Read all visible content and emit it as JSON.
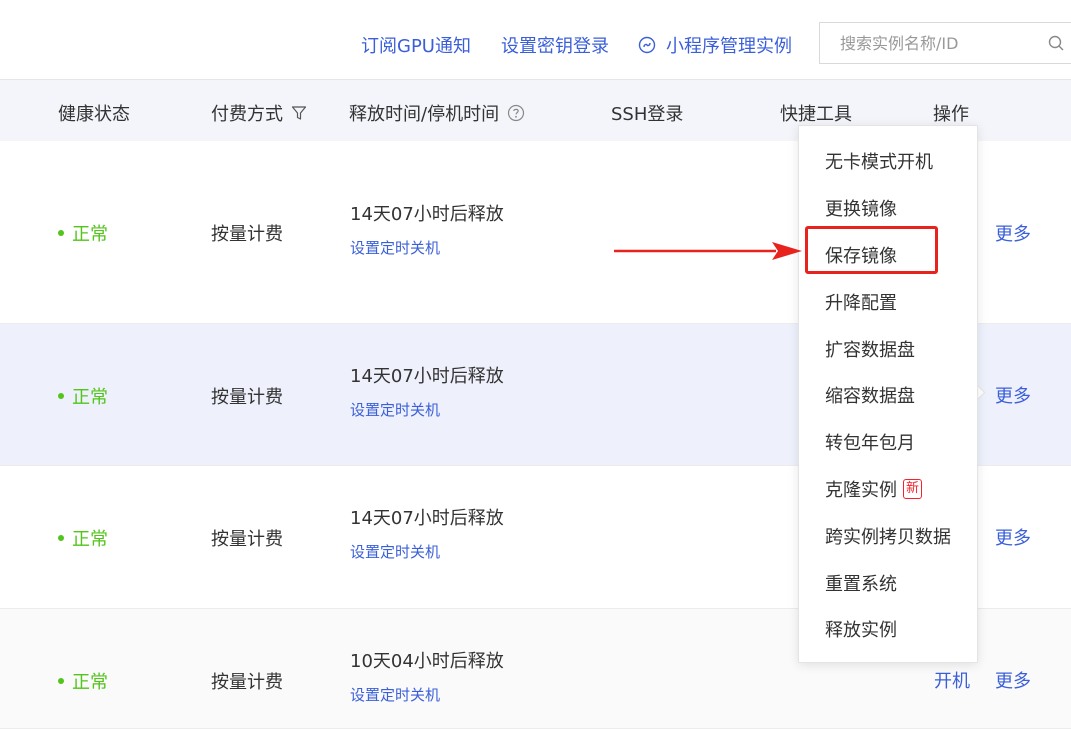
{
  "toolbar": {
    "subscribe_gpu": "订阅GPU通知",
    "set_key_login": "设置密钥登录",
    "miniapp_manage": "小程序管理实例",
    "search_placeholder": "搜索实例名称/ID"
  },
  "table": {
    "headers": {
      "health": "健康状态",
      "billing": "付费方式",
      "release": "释放时间/停机时间",
      "ssh": "SSH登录",
      "tools": "快捷工具",
      "actions": "操作"
    },
    "rows": [
      {
        "health": "正常",
        "billing": "按量计费",
        "release": "14天07小时后释放",
        "timer": "设置定时关机",
        "more": "更多"
      },
      {
        "health": "正常",
        "billing": "按量计费",
        "release": "14天07小时后释放",
        "timer": "设置定时关机",
        "more": "更多"
      },
      {
        "health": "正常",
        "billing": "按量计费",
        "release": "14天07小时后释放",
        "timer": "设置定时关机",
        "more": "更多"
      },
      {
        "health": "正常",
        "billing": "按量计费",
        "release": "10天04小时后释放",
        "timer": "设置定时关机",
        "power_on": "开机",
        "more": "更多"
      }
    ]
  },
  "dropdown": {
    "items": [
      "无卡模式开机",
      "更换镜像",
      "保存镜像",
      "升降配置",
      "扩容数据盘",
      "缩容数据盘",
      "转包年包月",
      "克隆实例",
      "跨实例拷贝数据",
      "重置系统",
      "释放实例"
    ],
    "new_badge": "新",
    "highlighted_item": "保存镜像"
  },
  "colors": {
    "link": "#3b5fd9",
    "status_ok": "#52c41a",
    "highlight": "#e8231e",
    "header_bg": "#f3f5fa",
    "selected_row_bg": "#eef1fc"
  },
  "icons": [
    "miniapp-icon",
    "search-icon",
    "filter-icon",
    "help-circle-icon"
  ]
}
